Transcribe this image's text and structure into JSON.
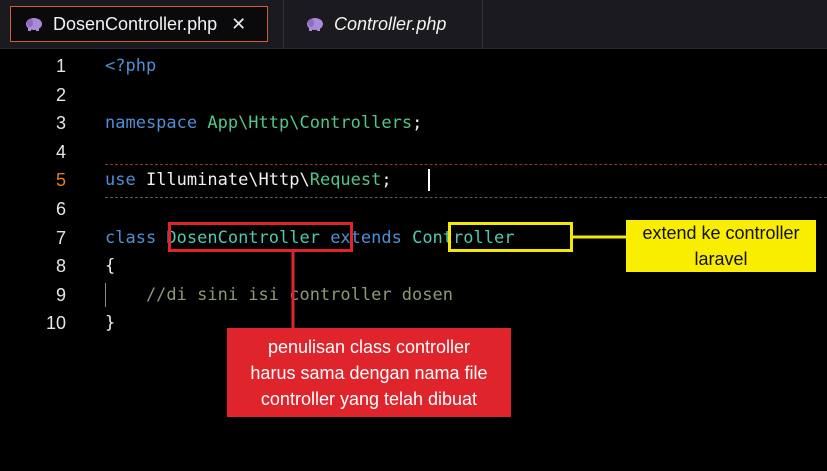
{
  "tabs": [
    {
      "label": "DosenController.php",
      "close": "✕",
      "icon": "php-elephant-icon",
      "active": true
    },
    {
      "label": "Controller.php",
      "icon": "php-elephant-icon",
      "active": false
    }
  ],
  "editor": {
    "lines": [
      {
        "num": "1",
        "tokens": [
          {
            "t": "<?php",
            "c": "kw"
          }
        ]
      },
      {
        "num": "2",
        "tokens": []
      },
      {
        "num": "3",
        "tokens": [
          {
            "t": "namespace ",
            "c": "kw"
          },
          {
            "t": "App\\Http\\Controllers",
            "c": "ns"
          },
          {
            "t": ";",
            "c": "plain"
          }
        ]
      },
      {
        "num": "4",
        "tokens": []
      },
      {
        "num": "5",
        "tokens": [
          {
            "t": "use ",
            "c": "kw"
          },
          {
            "t": "Illuminate\\Http\\",
            "c": "plain"
          },
          {
            "t": "Request",
            "c": "ns"
          },
          {
            "t": ";",
            "c": "plain"
          }
        ],
        "current": true
      },
      {
        "num": "6",
        "tokens": []
      },
      {
        "num": "7",
        "tokens": [
          {
            "t": "class ",
            "c": "kw"
          },
          {
            "t": "DosenController",
            "c": "cls"
          },
          {
            "t": " extends ",
            "c": "kw"
          },
          {
            "t": "Controller",
            "c": "cls"
          }
        ]
      },
      {
        "num": "8",
        "tokens": [
          {
            "t": "{",
            "c": "plain"
          }
        ]
      },
      {
        "num": "9",
        "tokens": [
          {
            "t": "    //di sini isi controller dosen",
            "c": "cm"
          }
        ]
      },
      {
        "num": "10",
        "tokens": [
          {
            "t": "}",
            "c": "plain"
          }
        ]
      }
    ]
  },
  "annotations": {
    "red_callout": "penulisan class controller harus sama dengan nama file controller yang telah dibuat",
    "yellow_callout": "extend ke controller laravel"
  },
  "colors": {
    "keyword": "#4f8fd6",
    "namespace": "#52c58a",
    "class": "#4ec9b0",
    "comment": "#8a9a78",
    "current_line_number": "#e07a2e",
    "red_annotation": "#e0242c",
    "yellow_annotation": "#f4e900"
  }
}
